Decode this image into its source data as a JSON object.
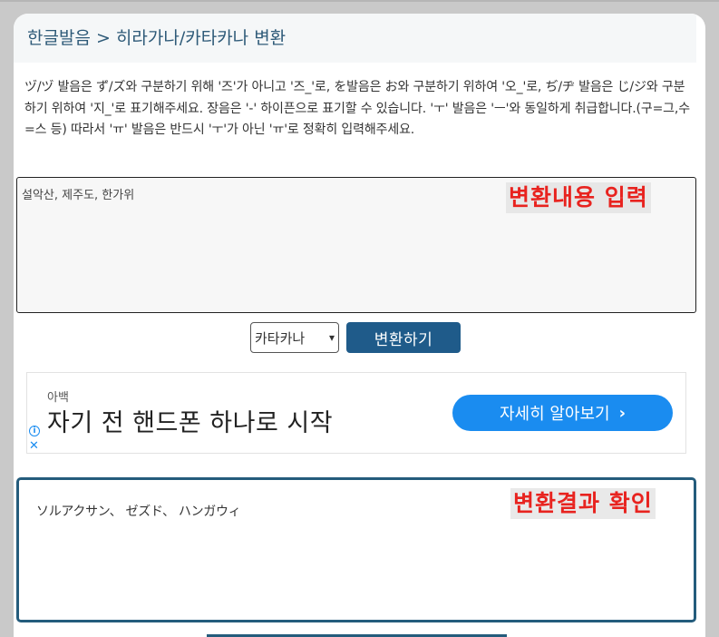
{
  "page": {
    "title": "한글발음 > 히라가나/카타카나 변환",
    "description": "ヅ/ヅ 발음은 ず/ズ와 구분하기 위해 '즈'가 아니고 '즈_'로, を발음은 お와 구분하기 위하여 '오_'로, ぢ/ヂ 발음은 じ/ジ와 구분하기 위하여 '지_'로 표기해주세요. 장음은 '-' 하이픈으로 표기할 수 있습니다. 'ㅜ' 발음은 'ㅡ'와 동일하게 취급합니다.(구=그,수=스 등) 따라서 'ㅠ' 발음은 반드시 'ㅜ'가 아닌 'ㅠ'로 정확히 입력해주세요."
  },
  "input": {
    "value": "설악산, 제주도, 한가위",
    "overlay_label": "변환내용 입력"
  },
  "controls": {
    "mode_selected": "카타카나",
    "convert_label": "변환하기"
  },
  "ad": {
    "small_text": "아백",
    "headline": "자기 전 핸드폰 하나로 시작",
    "cta_label": "자세히 알아보기",
    "cta_chevron": "›",
    "info_glyph": "i",
    "close_glyph": "✕"
  },
  "result": {
    "value": "ソルアクサン、 ゼズド、 ハンガウィ",
    "overlay_label": "변환결과 확인"
  },
  "colors": {
    "accent": "#245c7c",
    "button": "#1f5b8a",
    "ad_button": "#1a8cf0",
    "overlay_text": "#e8231f"
  }
}
